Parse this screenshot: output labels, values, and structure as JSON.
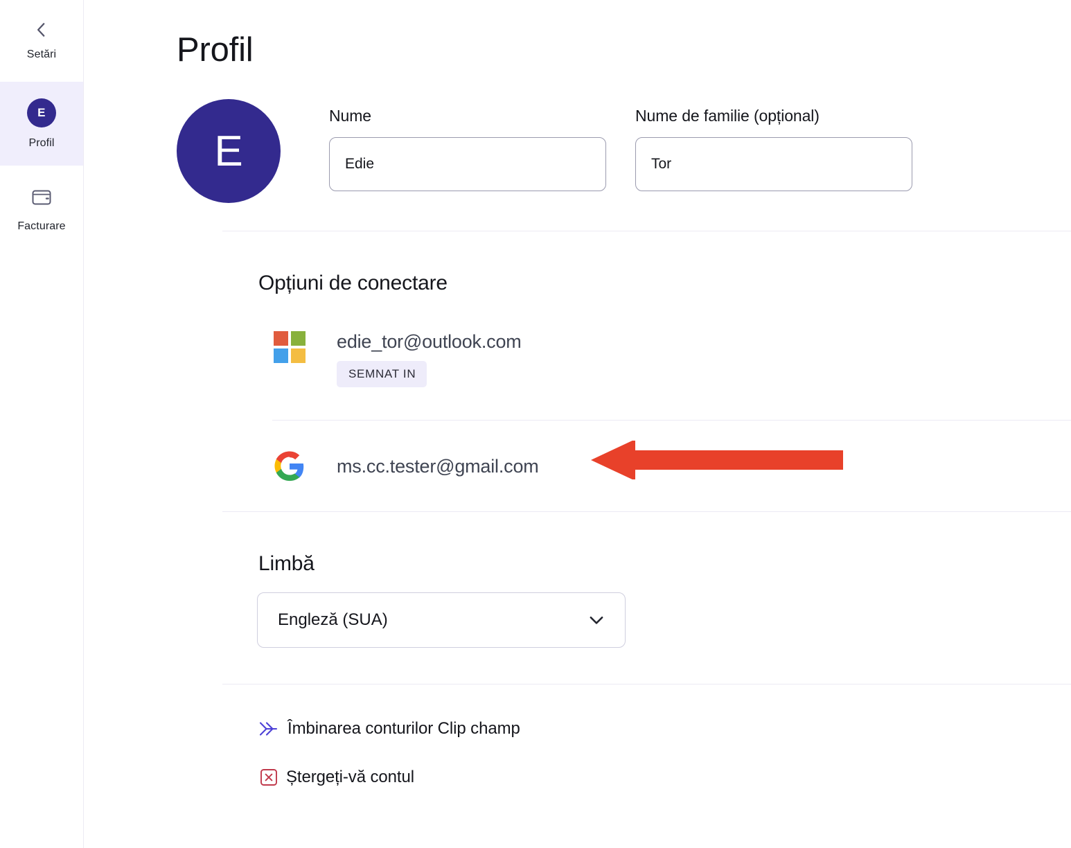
{
  "sidebar": {
    "back": {
      "label": "Setări",
      "icon": "chevron-left-icon"
    },
    "items": [
      {
        "id": "profil",
        "label": "Profil",
        "avatar_initial": "E",
        "icon": "avatar-icon",
        "selected": true
      },
      {
        "id": "facturare",
        "label": "Facturare",
        "icon": "wallet-icon",
        "selected": false
      }
    ]
  },
  "page": {
    "title": "Profil",
    "avatar_initial": "E"
  },
  "name_fields": {
    "first": {
      "label": "Nume",
      "value": "Edie",
      "placeholder": "Nume"
    },
    "last": {
      "label": "Nume de familie (opțional)",
      "value": "Tor",
      "placeholder": "Nume de familie"
    }
  },
  "signin_options": {
    "title": "Opțiuni de conectare",
    "accounts": [
      {
        "provider": "microsoft",
        "icon": "microsoft-logo-icon",
        "email": "edie_tor@outlook.com",
        "badge": "SEMNAT  IN"
      },
      {
        "provider": "google",
        "icon": "google-logo-icon",
        "email": "ms.cc.tester@gmail.com",
        "badge": ""
      }
    ]
  },
  "language": {
    "title": "Limbă",
    "selected": "Engleză (SUA)",
    "chevron": "chevron-down-icon"
  },
  "actions": [
    {
      "id": "merge-accounts",
      "label": "Îmbinarea conturilor Clip champ",
      "icon": "merge-arrows-icon"
    },
    {
      "id": "delete-account",
      "label": "Ștergeți-vă contul",
      "icon": "delete-box-icon"
    }
  ],
  "annotation": {
    "type": "arrow",
    "direction": "left",
    "color": "#e8412a",
    "points_at": "ms.cc.tester@gmail.com"
  },
  "colors": {
    "brand_purple": "#332a8e",
    "sidebar_selected": "#f0eefc",
    "badge_bg": "#eeecfa",
    "divider": "#eceaf4",
    "annotation_red": "#e8412a",
    "delete_red": "#c0394b",
    "merge_purple": "#4b3fd6"
  }
}
